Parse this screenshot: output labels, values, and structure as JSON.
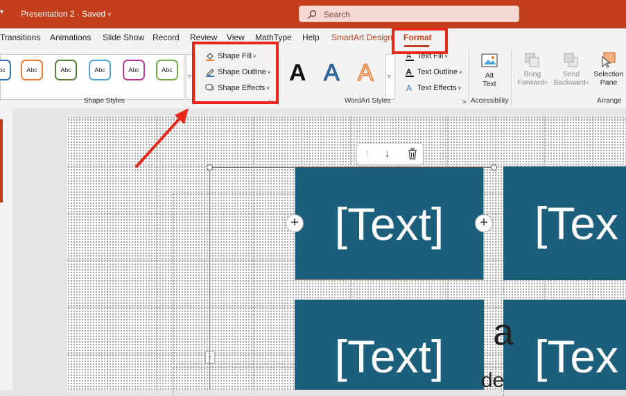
{
  "titlebar": {
    "doc_title": "Presentation 2 · Saved",
    "title_chevron": "˅",
    "quick_access_caret": "▾"
  },
  "search": {
    "placeholder": "Search"
  },
  "tabs": [
    {
      "label": "Transitions"
    },
    {
      "label": "Animations"
    },
    {
      "label": "Slide Show"
    },
    {
      "label": "Record"
    },
    {
      "label": "Review"
    },
    {
      "label": "View"
    },
    {
      "label": "MathType"
    },
    {
      "label": "Help"
    },
    {
      "label": "SmartArt Design"
    },
    {
      "label": "Format"
    }
  ],
  "ribbon": {
    "shape_styles": {
      "group_label": "Shape Styles",
      "swatch_text": "Abc",
      "swatch_colors": [
        "#2e75b6",
        "#ed7d31",
        "#548235",
        "#4ea6dc",
        "#c0399a",
        "#70ad47"
      ]
    },
    "shape_fill": "Shape Fill",
    "shape_outline": "Shape Outline",
    "shape_effects": "Shape Effects",
    "wordart": {
      "group_label": "WordArt Styles",
      "letters": [
        "A",
        "A",
        "A"
      ],
      "text_fill": "Text Fill",
      "text_outline": "Text Outline",
      "text_effects": "Text Effects"
    },
    "accessibility": {
      "group_label": "Accessibility",
      "alt_text_1": "Alt",
      "alt_text_2": "Text"
    },
    "arrange": {
      "group_label": "Arrange",
      "bring_forward_1": "Bring",
      "bring_forward_2": "Forward",
      "send_backward_1": "Send",
      "send_backward_2": "Backward",
      "selection_pane_1": "Selection",
      "selection_pane_2": "Pane"
    },
    "dropdown_caret": "˅",
    "gallery_more": "▿"
  },
  "slide": {
    "placeholder_text": "[Text]",
    "placeholder_text_partial": "[Tex",
    "side_glyph": "a",
    "side_glyph_bottom": "de",
    "plus": "+",
    "mini_up": "↑",
    "mini_down": "↓",
    "collapse": "‹"
  },
  "colors": {
    "accent": "#c43e1c",
    "tile": "#1b5f7d",
    "annotation": "#e8261a"
  }
}
